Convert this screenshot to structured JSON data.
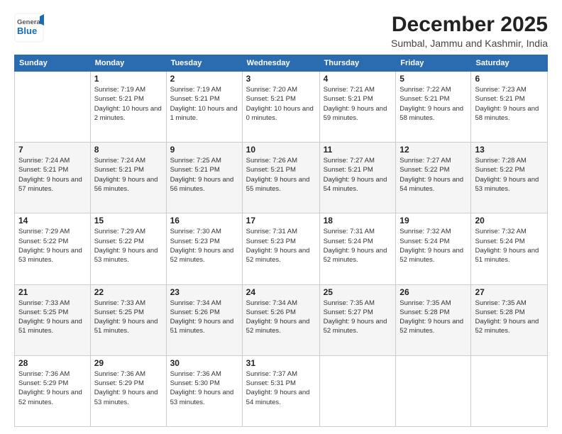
{
  "logo": {
    "general": "General",
    "blue": "Blue"
  },
  "header": {
    "month": "December 2025",
    "location": "Sumbal, Jammu and Kashmir, India"
  },
  "weekdays": [
    "Sunday",
    "Monday",
    "Tuesday",
    "Wednesday",
    "Thursday",
    "Friday",
    "Saturday"
  ],
  "weeks": [
    [
      {
        "day": "",
        "sunrise": "",
        "sunset": "",
        "daylight": ""
      },
      {
        "day": "1",
        "sunrise": "Sunrise: 7:19 AM",
        "sunset": "Sunset: 5:21 PM",
        "daylight": "Daylight: 10 hours and 2 minutes."
      },
      {
        "day": "2",
        "sunrise": "Sunrise: 7:19 AM",
        "sunset": "Sunset: 5:21 PM",
        "daylight": "Daylight: 10 hours and 1 minute."
      },
      {
        "day": "3",
        "sunrise": "Sunrise: 7:20 AM",
        "sunset": "Sunset: 5:21 PM",
        "daylight": "Daylight: 10 hours and 0 minutes."
      },
      {
        "day": "4",
        "sunrise": "Sunrise: 7:21 AM",
        "sunset": "Sunset: 5:21 PM",
        "daylight": "Daylight: 9 hours and 59 minutes."
      },
      {
        "day": "5",
        "sunrise": "Sunrise: 7:22 AM",
        "sunset": "Sunset: 5:21 PM",
        "daylight": "Daylight: 9 hours and 58 minutes."
      },
      {
        "day": "6",
        "sunrise": "Sunrise: 7:23 AM",
        "sunset": "Sunset: 5:21 PM",
        "daylight": "Daylight: 9 hours and 58 minutes."
      }
    ],
    [
      {
        "day": "7",
        "sunrise": "Sunrise: 7:24 AM",
        "sunset": "Sunset: 5:21 PM",
        "daylight": "Daylight: 9 hours and 57 minutes."
      },
      {
        "day": "8",
        "sunrise": "Sunrise: 7:24 AM",
        "sunset": "Sunset: 5:21 PM",
        "daylight": "Daylight: 9 hours and 56 minutes."
      },
      {
        "day": "9",
        "sunrise": "Sunrise: 7:25 AM",
        "sunset": "Sunset: 5:21 PM",
        "daylight": "Daylight: 9 hours and 56 minutes."
      },
      {
        "day": "10",
        "sunrise": "Sunrise: 7:26 AM",
        "sunset": "Sunset: 5:21 PM",
        "daylight": "Daylight: 9 hours and 55 minutes."
      },
      {
        "day": "11",
        "sunrise": "Sunrise: 7:27 AM",
        "sunset": "Sunset: 5:21 PM",
        "daylight": "Daylight: 9 hours and 54 minutes."
      },
      {
        "day": "12",
        "sunrise": "Sunrise: 7:27 AM",
        "sunset": "Sunset: 5:22 PM",
        "daylight": "Daylight: 9 hours and 54 minutes."
      },
      {
        "day": "13",
        "sunrise": "Sunrise: 7:28 AM",
        "sunset": "Sunset: 5:22 PM",
        "daylight": "Daylight: 9 hours and 53 minutes."
      }
    ],
    [
      {
        "day": "14",
        "sunrise": "Sunrise: 7:29 AM",
        "sunset": "Sunset: 5:22 PM",
        "daylight": "Daylight: 9 hours and 53 minutes."
      },
      {
        "day": "15",
        "sunrise": "Sunrise: 7:29 AM",
        "sunset": "Sunset: 5:22 PM",
        "daylight": "Daylight: 9 hours and 53 minutes."
      },
      {
        "day": "16",
        "sunrise": "Sunrise: 7:30 AM",
        "sunset": "Sunset: 5:23 PM",
        "daylight": "Daylight: 9 hours and 52 minutes."
      },
      {
        "day": "17",
        "sunrise": "Sunrise: 7:31 AM",
        "sunset": "Sunset: 5:23 PM",
        "daylight": "Daylight: 9 hours and 52 minutes."
      },
      {
        "day": "18",
        "sunrise": "Sunrise: 7:31 AM",
        "sunset": "Sunset: 5:24 PM",
        "daylight": "Daylight: 9 hours and 52 minutes."
      },
      {
        "day": "19",
        "sunrise": "Sunrise: 7:32 AM",
        "sunset": "Sunset: 5:24 PM",
        "daylight": "Daylight: 9 hours and 52 minutes."
      },
      {
        "day": "20",
        "sunrise": "Sunrise: 7:32 AM",
        "sunset": "Sunset: 5:24 PM",
        "daylight": "Daylight: 9 hours and 51 minutes."
      }
    ],
    [
      {
        "day": "21",
        "sunrise": "Sunrise: 7:33 AM",
        "sunset": "Sunset: 5:25 PM",
        "daylight": "Daylight: 9 hours and 51 minutes."
      },
      {
        "day": "22",
        "sunrise": "Sunrise: 7:33 AM",
        "sunset": "Sunset: 5:25 PM",
        "daylight": "Daylight: 9 hours and 51 minutes."
      },
      {
        "day": "23",
        "sunrise": "Sunrise: 7:34 AM",
        "sunset": "Sunset: 5:26 PM",
        "daylight": "Daylight: 9 hours and 51 minutes."
      },
      {
        "day": "24",
        "sunrise": "Sunrise: 7:34 AM",
        "sunset": "Sunset: 5:26 PM",
        "daylight": "Daylight: 9 hours and 52 minutes."
      },
      {
        "day": "25",
        "sunrise": "Sunrise: 7:35 AM",
        "sunset": "Sunset: 5:27 PM",
        "daylight": "Daylight: 9 hours and 52 minutes."
      },
      {
        "day": "26",
        "sunrise": "Sunrise: 7:35 AM",
        "sunset": "Sunset: 5:28 PM",
        "daylight": "Daylight: 9 hours and 52 minutes."
      },
      {
        "day": "27",
        "sunrise": "Sunrise: 7:35 AM",
        "sunset": "Sunset: 5:28 PM",
        "daylight": "Daylight: 9 hours and 52 minutes."
      }
    ],
    [
      {
        "day": "28",
        "sunrise": "Sunrise: 7:36 AM",
        "sunset": "Sunset: 5:29 PM",
        "daylight": "Daylight: 9 hours and 52 minutes."
      },
      {
        "day": "29",
        "sunrise": "Sunrise: 7:36 AM",
        "sunset": "Sunset: 5:29 PM",
        "daylight": "Daylight: 9 hours and 53 minutes."
      },
      {
        "day": "30",
        "sunrise": "Sunrise: 7:36 AM",
        "sunset": "Sunset: 5:30 PM",
        "daylight": "Daylight: 9 hours and 53 minutes."
      },
      {
        "day": "31",
        "sunrise": "Sunrise: 7:37 AM",
        "sunset": "Sunset: 5:31 PM",
        "daylight": "Daylight: 9 hours and 54 minutes."
      },
      {
        "day": "",
        "sunrise": "",
        "sunset": "",
        "daylight": ""
      },
      {
        "day": "",
        "sunrise": "",
        "sunset": "",
        "daylight": ""
      },
      {
        "day": "",
        "sunrise": "",
        "sunset": "",
        "daylight": ""
      }
    ]
  ]
}
